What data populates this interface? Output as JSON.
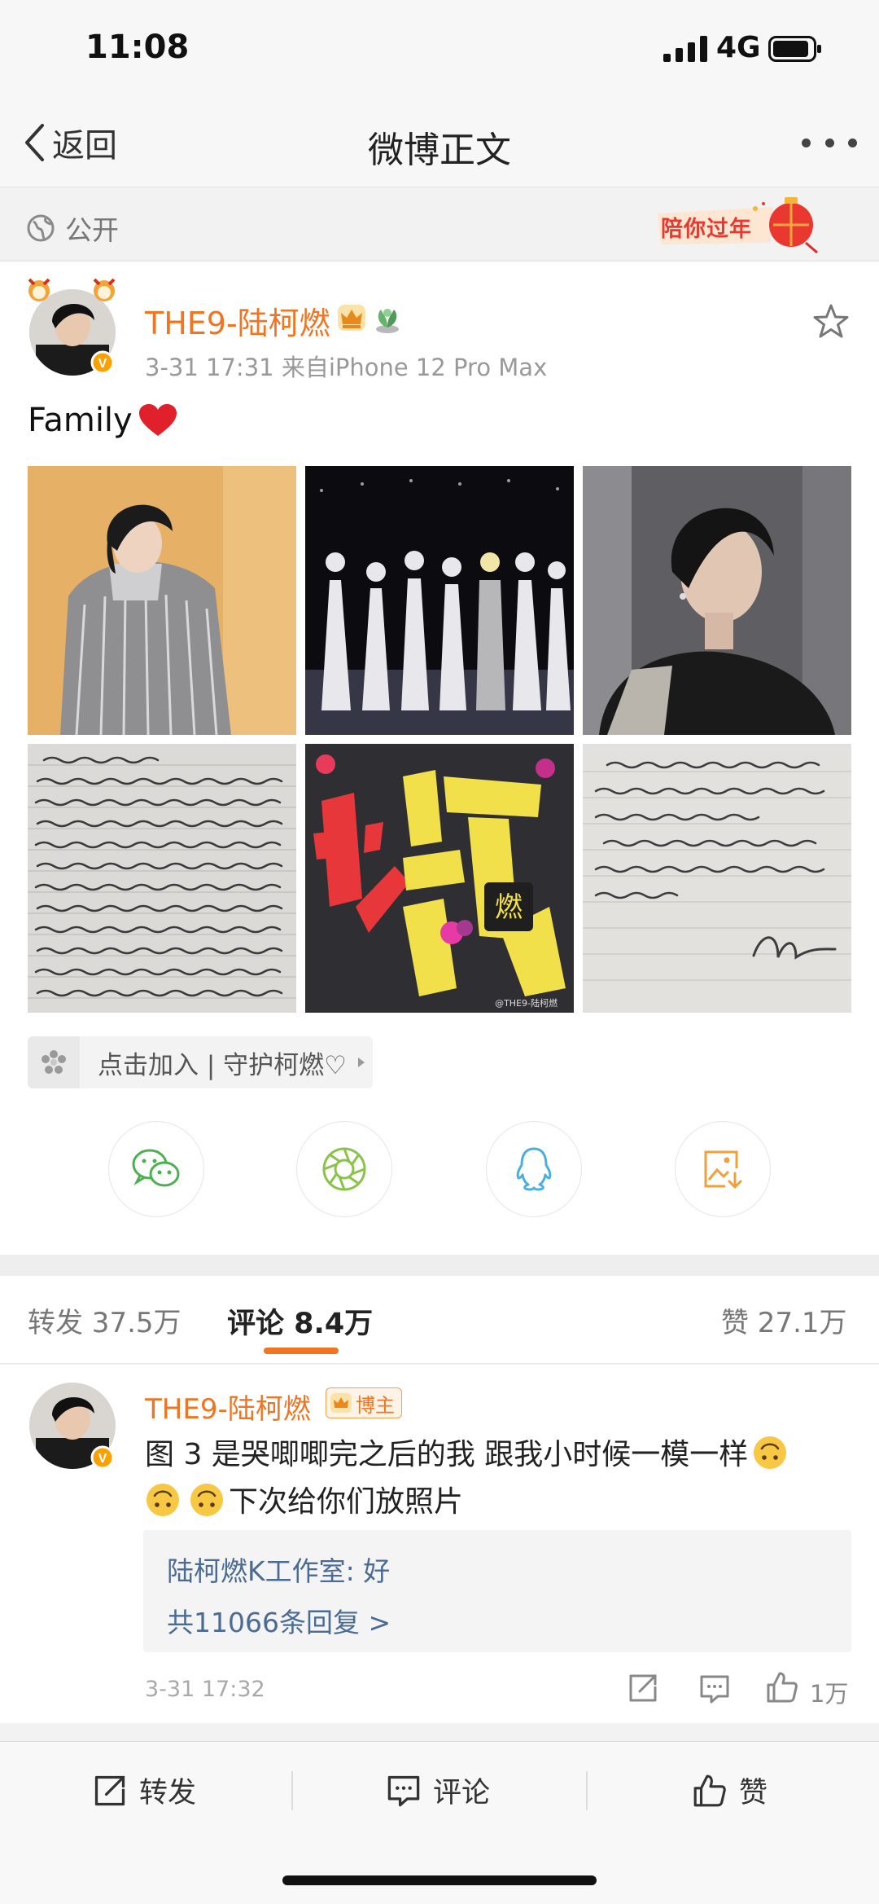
{
  "status_bar": {
    "time": "11:08",
    "network": "4G"
  },
  "nav": {
    "back_label": "返回",
    "title": "微博正文"
  },
  "visibility": {
    "label": "公开",
    "badge_text": "陪你过年"
  },
  "post": {
    "username": "THE9-陆柯燃",
    "meta": "3-31 17:31  来自iPhone 12 Pro Max",
    "text": "Family",
    "image_watermark": "@THE9-陆柯燃",
    "join_label": "点击加入 | 守护柯燃♡"
  },
  "share_targets": [
    "wechat-icon",
    "moments-icon",
    "qq-icon",
    "save-image-icon"
  ],
  "tabs": {
    "repost": "转发 37.5万",
    "comment": "评论 8.4万",
    "like": "赞 27.1万"
  },
  "comment": {
    "username": "THE9-陆柯燃",
    "tag": "博主",
    "text_part1": "图 3 是哭唧唧完之后的我 跟我小时候一模一样",
    "text_part2": "下次给你们放照片",
    "reply_preview": "陆柯燃K工作室: 好",
    "reply_count": "共11066条回复 >",
    "time": "3-31 17:32",
    "like_count": "1万"
  },
  "bottom_bar": {
    "repost": "转发",
    "comment": "评论",
    "like": "赞"
  },
  "colors": {
    "accent": "#f07522",
    "link": "#4a6b94"
  }
}
